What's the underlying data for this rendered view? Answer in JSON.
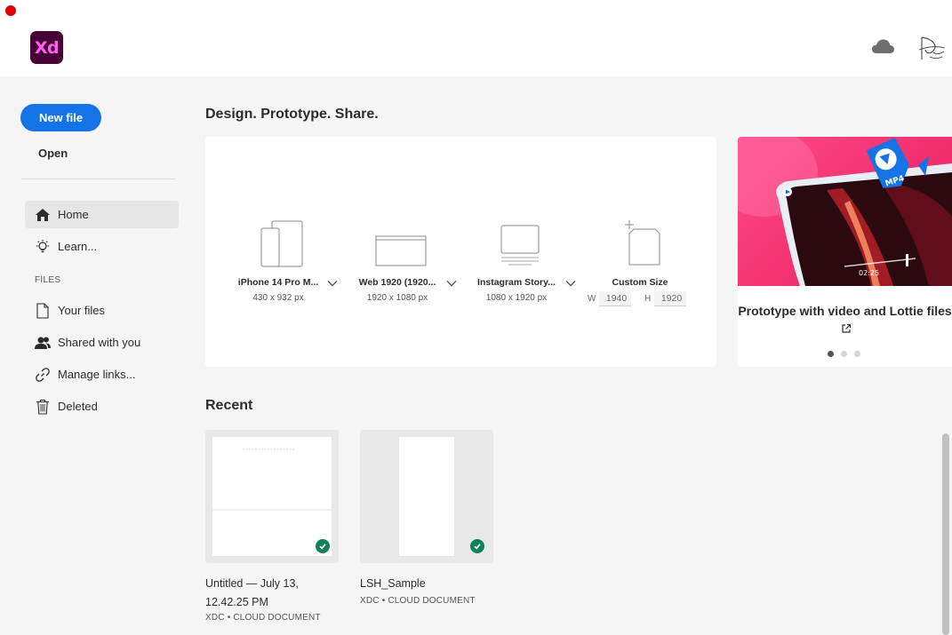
{
  "app": {
    "logo_text": "Xd"
  },
  "header": {
    "cloud_icon": "cloud-icon",
    "avatar_icon": "user-avatar"
  },
  "sidebar": {
    "new_file_label": "New file",
    "open_label": "Open",
    "nav": [
      {
        "label": "Home",
        "icon": "home-icon",
        "active": true
      },
      {
        "label": "Learn...",
        "icon": "lightbulb-icon"
      }
    ],
    "files_heading": "FILES",
    "files": [
      {
        "label": "Your files",
        "icon": "document-icon"
      },
      {
        "label": "Shared with you",
        "icon": "people-icon"
      },
      {
        "label": "Manage links...",
        "icon": "link-icon"
      },
      {
        "label": "Deleted",
        "icon": "trash-icon"
      }
    ]
  },
  "main": {
    "title": "Design. Prototype. Share.",
    "presets": [
      {
        "name": "iPhone 14 Pro M...",
        "size": "430 x 932 px",
        "icon": "phone-icon"
      },
      {
        "name": "Web 1920 (1920...",
        "size": "1920 x 1080 px",
        "icon": "browser-icon"
      },
      {
        "name": "Instagram Story...",
        "size": "1080 x 1920 px",
        "icon": "story-icon"
      },
      {
        "name": "Custom Size",
        "w_label": "W",
        "w_value": "1940",
        "h_label": "H",
        "h_value": "1920",
        "icon": "custom-size-icon"
      }
    ],
    "promo": {
      "title": "Prototype with video and Lottie files",
      "badge": "MP4",
      "video_time": "02:25",
      "dots": 3,
      "active_dot": 0
    },
    "recent_title": "Recent",
    "recent": [
      {
        "name": "Untitled — July 13, 12.42.25 PM",
        "type": "XDC • CLOUD DOCUMENT",
        "synced": true
      },
      {
        "name": "LSH_Sample",
        "type": "XDC • CLOUD DOCUMENT",
        "synced": true
      }
    ]
  },
  "colors": {
    "accent": "#1473e6",
    "logo_bg": "#470137",
    "logo_fg": "#ff61f6",
    "sync_check": "#12805c",
    "promo_pink": "#f2306f"
  }
}
